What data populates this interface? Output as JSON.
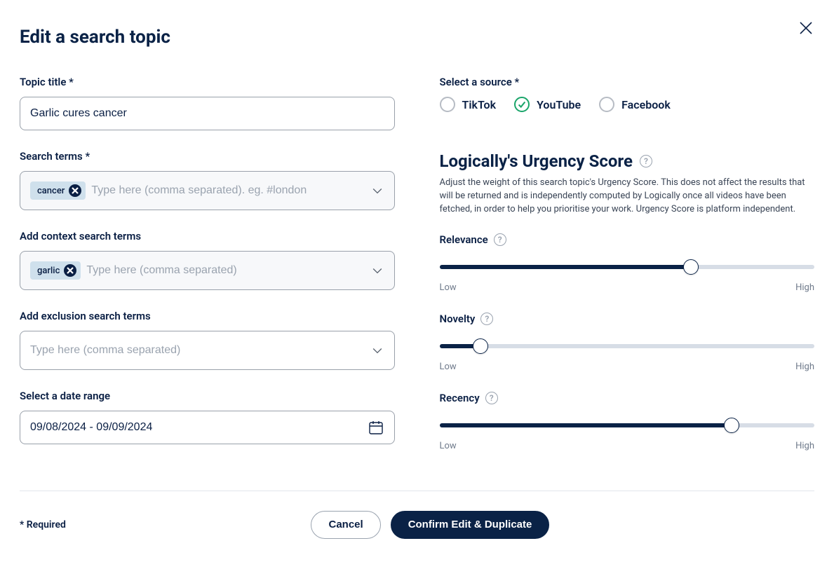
{
  "modal": {
    "title": "Edit a search topic",
    "required_note": "* Required"
  },
  "left": {
    "topic_title": {
      "label": "Topic title *",
      "value": "Garlic cures cancer"
    },
    "search_terms": {
      "label": "Search terms *",
      "chips": [
        "cancer"
      ],
      "placeholder": "Type here (comma separated). eg. #london"
    },
    "context_terms": {
      "label": "Add context search terms",
      "chips": [
        "garlic"
      ],
      "placeholder": "Type here (comma separated)"
    },
    "exclusion_terms": {
      "label": "Add exclusion search terms",
      "placeholder": "Type here (comma separated)"
    },
    "date_range": {
      "label": "Select a date range",
      "value": "09/08/2024 - 09/09/2024"
    }
  },
  "right": {
    "source": {
      "label": "Select a source *",
      "options": [
        {
          "key": "tiktok",
          "label": "TikTok",
          "selected": false
        },
        {
          "key": "youtube",
          "label": "YouTube",
          "selected": true
        },
        {
          "key": "facebook",
          "label": "Facebook",
          "selected": false
        }
      ]
    },
    "urgency": {
      "heading": "Logically's Urgency Score",
      "description": "Adjust the weight of this search topic's Urgency Score. This does not affect the results that will be returned and is independently computed by Logically once all videos have been fetched, in order to help you prioritise your work. Urgency Score is platform independent.",
      "scale_low": "Low",
      "scale_high": "High",
      "sliders": [
        {
          "key": "relevance",
          "label": "Relevance",
          "value": 67
        },
        {
          "key": "novelty",
          "label": "Novelty",
          "value": 11
        },
        {
          "key": "recency",
          "label": "Recency",
          "value": 78
        }
      ]
    }
  },
  "footer": {
    "cancel": "Cancel",
    "confirm": "Confirm Edit & Duplicate"
  }
}
